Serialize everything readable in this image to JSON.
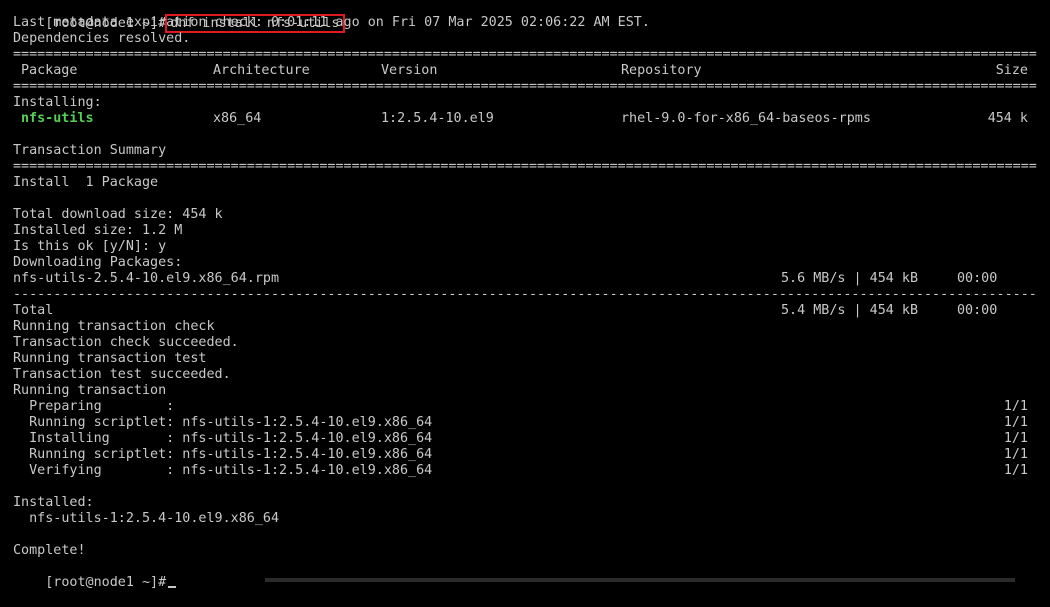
{
  "terminal": {
    "prompt": "[root@node1 ~]#",
    "command": "dnf install nfs-utils",
    "metadata_line": "Last metadata expiration check: 0:01:11 ago on Fri 07 Mar 2025 02:06:22 AM EST.",
    "deps_resolved": "Dependencies resolved.",
    "rule_double": "==========================================================================================================================================",
    "rule_single": "------------------------------------------------------------------------------------------------------------------------------------------",
    "table": {
      "headers": [
        "Package",
        "Architecture",
        "Version",
        "Repository",
        "Size"
      ],
      "section_label": "Installing:",
      "rows": [
        {
          "package": "nfs-utils",
          "arch": "x86_64",
          "version": "1:2.5.4-10.el9",
          "repo": "rhel-9.0-for-x86_64-baseos-rpms",
          "size": "454 k"
        }
      ]
    },
    "transaction_summary": "Transaction Summary",
    "install_count": "Install  1 Package",
    "total_download": "Total download size: 454 k",
    "installed_size": "Installed size: 1.2 M",
    "confirm_prompt": "Is this ok [y/N]: y",
    "downloading": "Downloading Packages:",
    "download_file": {
      "name": "nfs-utils-2.5.4-10.el9.x86_64.rpm",
      "speed": "5.6 MB/s | 454 kB",
      "time": "00:00"
    },
    "total": {
      "label": "Total",
      "speed": "5.4 MB/s | 454 kB",
      "time": "00:00"
    },
    "transaction_lines": [
      "Running transaction check",
      "Transaction check succeeded.",
      "Running transaction test",
      "Transaction test succeeded.",
      "Running transaction"
    ],
    "steps": [
      {
        "text": "  Preparing        :",
        "count": "1/1"
      },
      {
        "text": "  Running scriptlet: nfs-utils-1:2.5.4-10.el9.x86_64",
        "count": "1/1"
      },
      {
        "text": "  Installing       : nfs-utils-1:2.5.4-10.el9.x86_64",
        "count": "1/1"
      },
      {
        "text": "  Running scriptlet: nfs-utils-1:2.5.4-10.el9.x86_64",
        "count": "1/1"
      },
      {
        "text": "  Verifying        : nfs-utils-1:2.5.4-10.el9.x86_64",
        "count": "1/1"
      }
    ],
    "installed_label": "Installed:",
    "installed_package": "  nfs-utils-1:2.5.4-10.el9.x86_64",
    "complete": "Complete!",
    "final_prompt": "[root@node1 ~]#"
  },
  "colors": {
    "background": "#000000",
    "text": "#c8c8c8",
    "package_highlight": "#55d155",
    "command_box": "#e0191e"
  }
}
